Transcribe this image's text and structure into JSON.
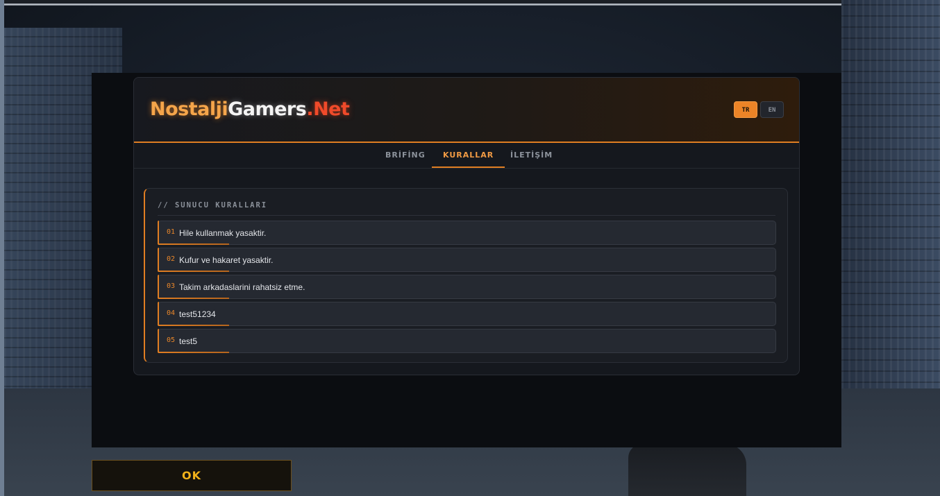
{
  "header": {
    "logo_part1": "Nostalji",
    "logo_part2": "Gamers",
    "logo_part3": ".Net",
    "languages": [
      {
        "code": "TR",
        "active": true
      },
      {
        "code": "EN",
        "active": false
      }
    ]
  },
  "tabs": [
    {
      "label": "BRİFİNG",
      "active": false
    },
    {
      "label": "KURALLAR",
      "active": true
    },
    {
      "label": "İLETİŞİM",
      "active": false
    }
  ],
  "rules_panel": {
    "title": "// SUNUCU KURALLARI",
    "items": [
      {
        "num": "01",
        "text": "Hile kullanmak yasaktir."
      },
      {
        "num": "02",
        "text": "Kufur ve hakaret yasaktir."
      },
      {
        "num": "03",
        "text": "Takim arkadaslarini rahatsiz etme."
      },
      {
        "num": "04",
        "text": "test51234"
      },
      {
        "num": "05",
        "text": "test5"
      }
    ]
  },
  "footer": {
    "ok_label": "OK"
  },
  "colors": {
    "accent": "#e07e22",
    "ok_text": "#f2b21a"
  }
}
